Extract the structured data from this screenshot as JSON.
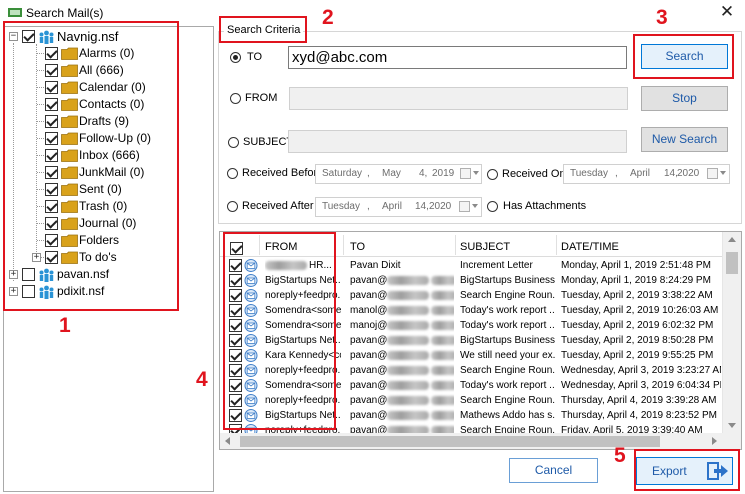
{
  "window": {
    "title": "Search Mail(s)"
  },
  "tree": {
    "root": "Navnig.nsf",
    "folders": [
      "Alarms (0)",
      "All (666)",
      "Calendar (0)",
      "Contacts (0)",
      "Drafts (9)",
      "Follow-Up (0)",
      "Inbox (666)",
      "JunkMail (0)",
      "Sent (0)",
      "Trash (0)",
      "Journal (0)",
      "Folders",
      "To do's"
    ],
    "others": [
      "pavan.nsf",
      "pdixit.nsf"
    ]
  },
  "criteria": {
    "legend": "Search Criteria",
    "to_label": "TO",
    "to_value": "xyd@abc.com",
    "from_label": "FROM",
    "subject_label": "SUBJECT",
    "received_before_label": "Received Before",
    "received_before_date": {
      "weekday": "Saturday",
      "month": "May",
      "day": "4,",
      "year": "2019"
    },
    "received_on_label": "Received On",
    "received_on_date": {
      "weekday": "Tuesday",
      "month": "April",
      "day": "14,",
      "year": "2020"
    },
    "received_after_label": "Received After",
    "received_after_date": {
      "weekday": "Tuesday",
      "month": "April",
      "day": "14,",
      "year": "2020"
    },
    "has_attachments_label": "Has Attachments"
  },
  "buttons": {
    "search": "Search",
    "stop": "Stop",
    "new_search": "New Search",
    "cancel": "Cancel",
    "export": "Export"
  },
  "grid": {
    "columns": [
      "FROM",
      "TO",
      "SUBJECT",
      "DATE/TIME"
    ],
    "rows": [
      {
        "from": "HR...",
        "from_blur": true,
        "to": "Pavan Dixit",
        "to_blur": false,
        "subject": "Increment Letter",
        "date": "Monday, April 1, 2019 2:51:48 PM"
      },
      {
        "from": "BigStartups Net...",
        "from_blur": false,
        "to": "pavan@",
        "to_blur": true,
        "subject": "BigStartups Business...",
        "date": "Monday, April 1, 2019 8:24:29 PM"
      },
      {
        "from": "noreply+feedpro...",
        "from_blur": false,
        "to": "pavan@",
        "to_blur": true,
        "subject": "Search Engine Roun...",
        "date": "Tuesday, April 2, 2019 3:38:22 AM"
      },
      {
        "from": "Somendra<some...",
        "from_blur": false,
        "to": "manol@",
        "to_blur": true,
        "subject": "Today's work report ...",
        "date": "Tuesday, April 2, 2019 10:26:03 AM"
      },
      {
        "from": "Somendra<some...",
        "from_blur": false,
        "to": "manoj@",
        "to_blur": true,
        "subject": "Today's work report ...",
        "date": "Tuesday, April 2, 2019 6:02:32 PM"
      },
      {
        "from": "BigStartups Net...",
        "from_blur": false,
        "to": "pavan@",
        "to_blur": true,
        "subject": "BigStartups Business...",
        "date": "Tuesday, April 2, 2019 8:50:28 PM"
      },
      {
        "from": "Kara Kennedy<co...",
        "from_blur": false,
        "to": "pavan@",
        "to_blur": true,
        "subject": "We still need your ex...",
        "date": "Tuesday, April 2, 2019 9:55:25 PM"
      },
      {
        "from": "noreply+feedpro...",
        "from_blur": false,
        "to": "pavan@",
        "to_blur": true,
        "subject": "Search Engine Roun...",
        "date": "Wednesday, April 3, 2019 3:23:27 AM"
      },
      {
        "from": "Somendra<some...",
        "from_blur": false,
        "to": "pavan@",
        "to_blur": true,
        "subject": "Today's work report ...",
        "date": "Wednesday, April 3, 2019 6:04:34 PM"
      },
      {
        "from": "noreply+feedpro...",
        "from_blur": false,
        "to": "pavan@",
        "to_blur": true,
        "subject": "Search Engine Roun...",
        "date": "Thursday, April 4, 2019 3:39:28 AM"
      },
      {
        "from": "BigStartups Net...",
        "from_blur": false,
        "to": "pavan@",
        "to_blur": true,
        "subject": "Mathews Addo has s...",
        "date": "Thursday, April 4, 2019 8:23:52 PM"
      },
      {
        "from": "noreply+feedpro...",
        "from_blur": false,
        "to": "pavan@",
        "to_blur": true,
        "subject": "Search Engine Roun...",
        "date": "Friday, April 5, 2019 3:39:40 AM"
      }
    ]
  },
  "annotations": [
    "1",
    "2",
    "3",
    "4",
    "5"
  ],
  "colors": {
    "annotation": "#e0141e",
    "link_blue": "#1e5aa8",
    "folder": "#d9a21b",
    "accent": "#0078d7"
  }
}
